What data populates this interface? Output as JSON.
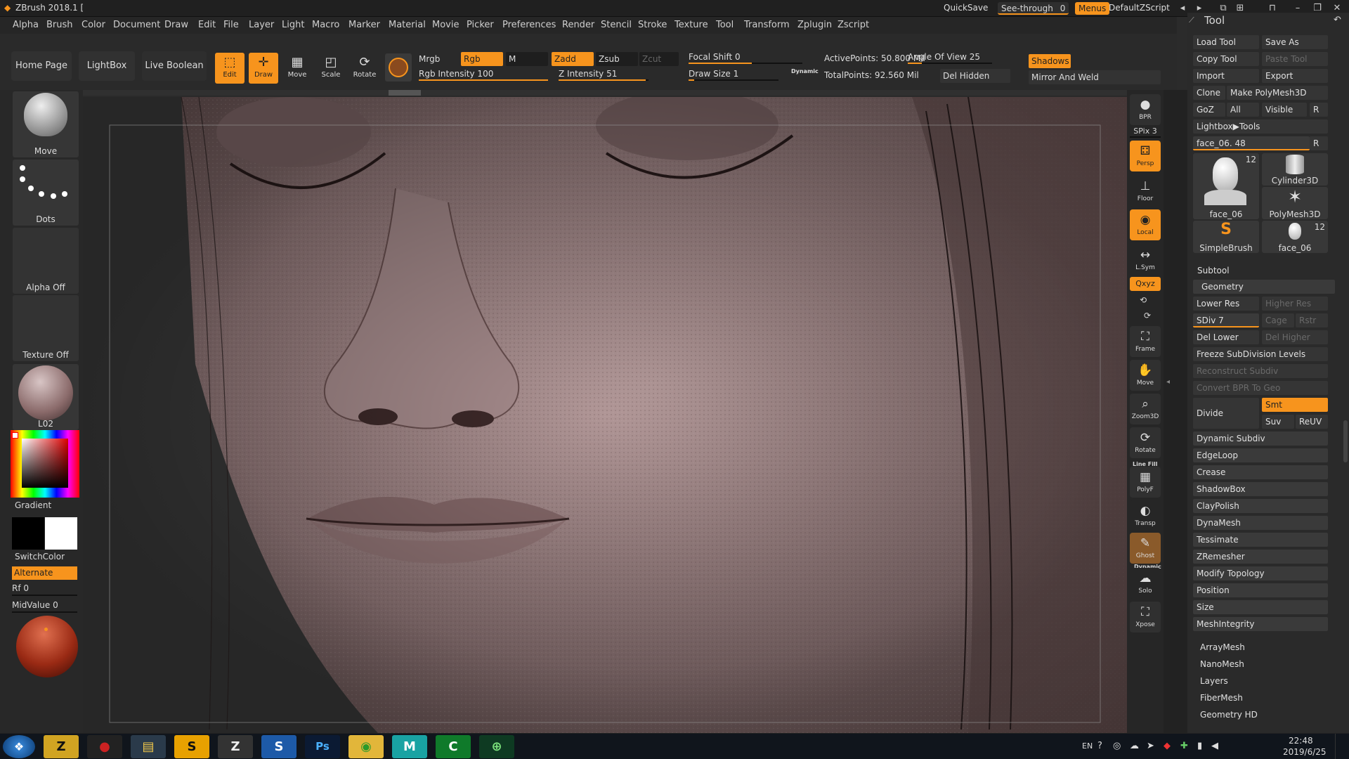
{
  "title_bar": {
    "app_title": "ZBrush 2018.1 [",
    "quicksave": "QuickSave",
    "see_through": "See-through",
    "see_through_value": "0",
    "menus": "Menus",
    "script": "DefaultZScript"
  },
  "menu": [
    "Alpha",
    "Brush",
    "Color",
    "Document",
    "Draw",
    "Edit",
    "File",
    "Layer",
    "Light",
    "Macro",
    "Marker",
    "Material",
    "Movie",
    "Picker",
    "Preferences",
    "Render",
    "Stencil",
    "Stroke",
    "Texture",
    "Tool",
    "Transform",
    "Zplugin",
    "Zscript"
  ],
  "shelf": {
    "home": "Home Page",
    "lightbox": "LightBox",
    "live_boolean": "Live Boolean",
    "tools": [
      "Edit",
      "Draw",
      "Move",
      "Scale",
      "Rotate"
    ],
    "mrgb": "Mrgb",
    "rgb": "Rgb",
    "m": "M",
    "zadd": "Zadd",
    "zsub": "Zsub",
    "zcut": "Zcut",
    "rgb_intensity": "Rgb Intensity 100",
    "z_intensity": "Z Intensity 51",
    "focal_shift": "Focal Shift 0",
    "draw_size": "Draw Size 1",
    "dynamic": "Dynamic",
    "active_points": "ActivePoints: 50.800 Mil",
    "angle_of_view": "Angle Of View 25",
    "total_points": "TotalPoints: 92.560 Mil",
    "del_hidden": "Del Hidden",
    "shadows": "Shadows",
    "mirror_weld": "Mirror And Weld"
  },
  "left_panel": {
    "brush": "Move",
    "stroke": "Dots",
    "alpha": "Alpha Off",
    "texture": "Texture Off",
    "material": "L02",
    "gradient": "Gradient",
    "switch_color": "SwitchColor",
    "alternate": "Alternate",
    "rf": "Rf 0",
    "midvalue": "MidValue 0"
  },
  "right_toolbar": {
    "bpr": "BPR",
    "spix": "SPix 3",
    "dynamic": "Dynamic",
    "persp": "Persp",
    "floor": "Floor",
    "local": "Local",
    "lsym": "L.Sym",
    "xyz": "Qxyz",
    "frame": "Frame",
    "move": "Move",
    "zoom3d": "Zoom3D",
    "rotate": "Rotate",
    "line_fill": "Line Fill",
    "polyf": "PolyF",
    "transp": "Transp",
    "ghost": "Ghost",
    "solo": "Solo",
    "xpose": "Xpose"
  },
  "tool_palette": {
    "title": "Tool",
    "load_tool": "Load Tool",
    "save_as": "Save As",
    "copy_tool": "Copy Tool",
    "paste_tool": "Paste Tool",
    "import": "Import",
    "export": "Export",
    "clone": "Clone",
    "make_polymesh": "Make PolyMesh3D",
    "goz": "GoZ",
    "all": "All",
    "visible": "Visible",
    "r": "R",
    "lightbox_tools": "Lightbox▶Tools",
    "current_tool": "face_06. 48",
    "thumbs": [
      {
        "label": "face_06",
        "count": "12"
      },
      {
        "label": "Cylinder3D",
        "count": ""
      },
      {
        "label": "PolyMesh3D",
        "count": ""
      },
      {
        "label": "SimpleBrush",
        "count": ""
      },
      {
        "label": "face_06",
        "count": "12"
      }
    ],
    "subtool": "Subtool",
    "geometry": "Geometry",
    "lower_res": "Lower Res",
    "higher_res": "Higher Res",
    "sdiv": "SDiv 7",
    "cage": "Cage",
    "rstr": "Rstr",
    "del_lower": "Del Lower",
    "del_higher": "Del Higher",
    "freeze": "Freeze SubDivision Levels",
    "reconstruct": "Reconstruct Subdiv",
    "convert_bpr": "Convert BPR To Geo",
    "divide": "Divide",
    "smt": "Smt",
    "suv": "Suv",
    "reuv": "ReUV",
    "geometry_items": [
      "Dynamic Subdiv",
      "EdgeLoop",
      "Crease",
      "ShadowBox",
      "ClayPolish",
      "DynaMesh",
      "Tessimate",
      "ZRemesher",
      "Modify Topology",
      "Position",
      "Size",
      "MeshIntegrity"
    ],
    "section_items": [
      "ArrayMesh",
      "NanoMesh",
      "Layers",
      "FiberMesh",
      "Geometry HD"
    ]
  },
  "taskbar": {
    "apps": [
      "ZBrush",
      "Recorder",
      "Explorer",
      "Sublime",
      "ZBrush Central",
      "Sketch",
      "Photoshop",
      "WeChat",
      "Maya",
      "Camtasia",
      "Browser"
    ],
    "lang": "EN",
    "time": "22:48",
    "date": "2019/6/25"
  },
  "colors": {
    "accent": "#f7941d",
    "primary_color": "#000000",
    "secondary_color": "#ffffff",
    "skin": "#a48a8a"
  }
}
